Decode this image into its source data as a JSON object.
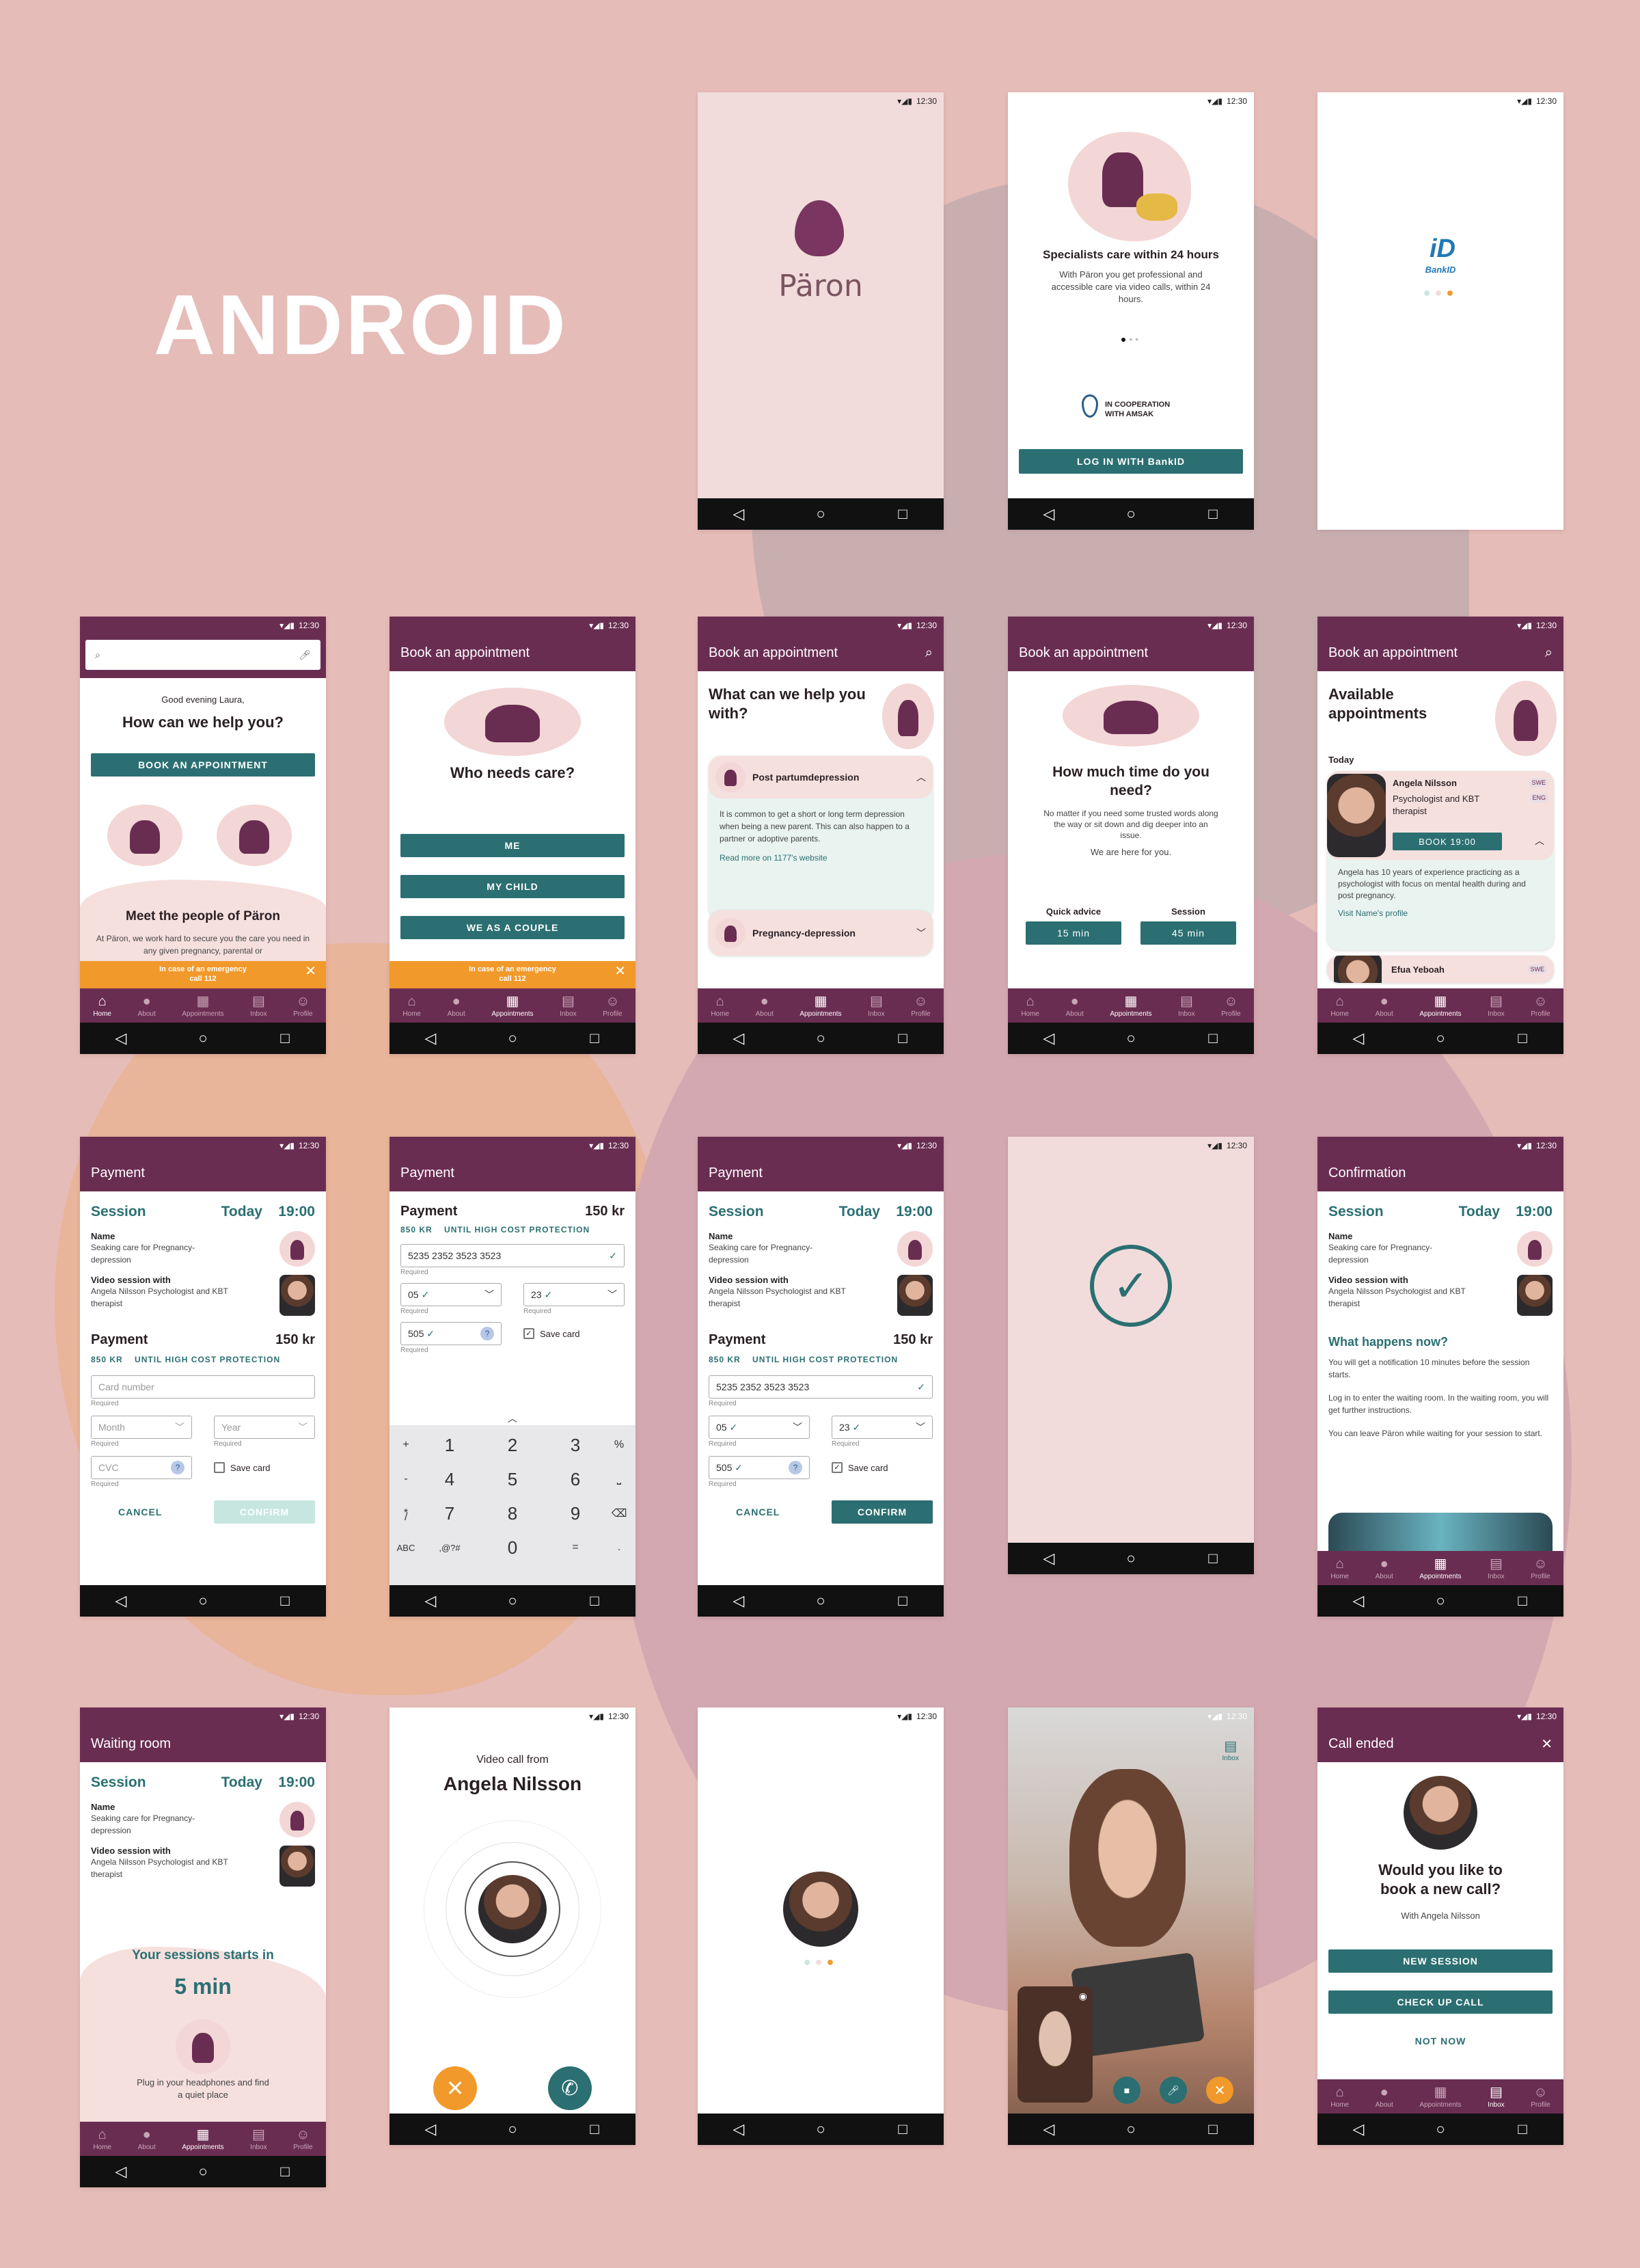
{
  "page": {
    "heading": "ANDROID"
  },
  "status": {
    "time": "12:30"
  },
  "nav": {
    "back": "◁",
    "home": "○",
    "recent": "□"
  },
  "tabs": {
    "home": "Home",
    "about": "About",
    "appointments": "Appointments",
    "inbox": "Inbox",
    "profile": "Profile"
  },
  "splash": {
    "logo": "Päron"
  },
  "onboarding": {
    "title": "Specialists care within 24 hours",
    "body": "With Päron you get professional and accessible care via video calls, within 24 hours.",
    "coop_line1": "IN COOPERATION",
    "coop_line2": "WITH AMSAK",
    "login_button": "LOG IN WITH BankID"
  },
  "bankid": {
    "logo_text": "BankID"
  },
  "home": {
    "greeting": "Good evening Laura,",
    "question": "How can we help you?",
    "book_button": "BOOK AN APPOINTMENT",
    "meet_title": "Meet the people of Päron",
    "meet_body": "At Päron, we work hard to secure you the care you need in any given pregnancy, parental or",
    "emergency_line1": "In case of an emergency",
    "emergency_line2": "call 112"
  },
  "booking": {
    "title": "Book an appointment",
    "who_question": "Who needs care?",
    "opt_me": "ME",
    "opt_child": "MY CHILD",
    "opt_couple": "WE AS A COUPLE"
  },
  "help": {
    "question": "What can we help you with?",
    "topic1": "Post partumdepression",
    "topic1_body": "It is common to get a short or long term depression when being a new parent. This can also happen to a partner or adoptive parents.",
    "topic1_link": "Read more on 1177's website",
    "topic2": "Pregnancy-depression"
  },
  "duration": {
    "question": "How much time do you need?",
    "body": "No matter if you need some trusted words along the way or sit down and dig deeper into an issue.",
    "here": "We are here for you.",
    "quick_label": "Quick advice",
    "quick_value": "15 min",
    "session_label": "Session",
    "session_value": "45 min"
  },
  "available": {
    "title": "Available appointments",
    "today": "Today",
    "name1": "Angela Nilsson",
    "role1": "Psychologist and KBT therapist",
    "book1": "BOOK 19:00",
    "bio1": "Angela has 10 years of experience practicing as a psychologist with focus on mental health during and post pregnancy.",
    "visit1": "Visit Name's profile",
    "name2": "Efua Yeboah",
    "lang1": "SWE",
    "lang2": "ENG"
  },
  "payment": {
    "title": "Payment",
    "session": "Session",
    "today": "Today",
    "time": "19:00",
    "name_label": "Name",
    "name_value": "Seaking care for Pregnancy-depression",
    "video_label": "Video session with",
    "video_value": "Angela Nilsson Psychologist and KBT therapist",
    "payment_label": "Payment",
    "price": "150 kr",
    "kr850": "850 KR",
    "until": "UNTIL HIGH COST PROTECTION",
    "card_placeholder": "Card number",
    "card_value": "5235 2352 3523 3523",
    "required": "Required",
    "month_placeholder": "Month",
    "year_placeholder": "Year",
    "month_value": "05",
    "year_value": "23",
    "cvc_placeholder": "CVC",
    "cvc_value": "505",
    "save_card": "Save card",
    "cancel": "CANCEL",
    "confirm": "CONFIRM"
  },
  "keypad": {
    "k1": "1",
    "k2": "2",
    "k3": "3",
    "k4": "4",
    "k5": "5",
    "k6": "6",
    "k7": "7",
    "k8": "8",
    "k9": "9",
    "k0": "0",
    "plus": "+",
    "minus": "-",
    "star": "*",
    "slash": "/",
    "percent": "%",
    "space": "⎵",
    "abc": "ABC",
    "sym": ",@?#",
    "equals": "=",
    "dot": "."
  },
  "confirmation": {
    "title": "Confirmation",
    "happens": "What happens now?",
    "p1": "You will get a notification 10 minutes before the session starts.",
    "p2": "Log in to enter the waiting room. In the waiting room, you will get further instructions.",
    "p3": "You can leave Päron while waiting for your session to start."
  },
  "waiting": {
    "title": "Waiting room",
    "starts": "Your sessions starts in",
    "countdown": "5 min",
    "tip": "Plug in your headphones and find a quiet place"
  },
  "incoming": {
    "from": "Video call from",
    "name": "Angela Nilsson"
  },
  "videocall": {
    "inbox": "Inbox"
  },
  "callended": {
    "title": "Call ended",
    "question": "Would you like to book a new call?",
    "with": "With Angela Nilsson",
    "new_session": "NEW SESSION",
    "check_up": "CHECK UP CALL",
    "not_now": "NOT NOW"
  },
  "colors": {
    "plum": "#6a2d52",
    "teal": "#2b6f72",
    "orange": "#f1992a",
    "pink_bg": "#e6bcb8"
  }
}
